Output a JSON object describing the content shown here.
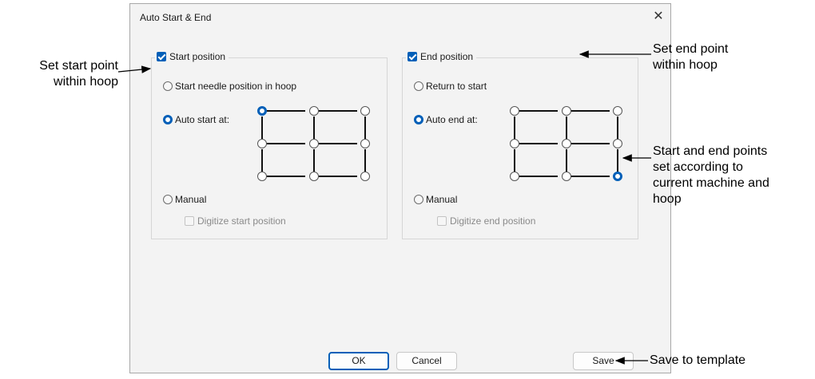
{
  "dialog": {
    "title": "Auto Start & End",
    "close_glyph": "✕"
  },
  "start_group": {
    "label": "Start position",
    "checked": true,
    "options": {
      "needle": "Start needle position in hoop",
      "auto": "Auto start at:",
      "manual": "Manual"
    },
    "selected": "auto",
    "digitize_label": "Digitize start position",
    "grid_selected": "top-left"
  },
  "end_group": {
    "label": "End position",
    "checked": true,
    "options": {
      "return": "Return to start",
      "auto": "Auto end at:",
      "manual": "Manual"
    },
    "selected": "auto",
    "digitize_label": "Digitize end position",
    "grid_selected": "bottom-right"
  },
  "buttons": {
    "ok": "OK",
    "cancel": "Cancel",
    "save": "Save"
  },
  "annotations": {
    "start_1": "Set start point",
    "start_2": "within hoop",
    "end_1": "Set end point",
    "end_2": "within hoop",
    "points_1": "Start and end points",
    "points_2": "set according to",
    "points_3": "current machine and",
    "points_4": "hoop",
    "save": "Save to template"
  },
  "colors": {
    "accent": "#005fb8",
    "dialog_bg": "#f3f3f3",
    "disabled_text": "#8a8a8a"
  },
  "icons": {
    "close": "close-icon",
    "checkbox": "checkbox-icon",
    "radio": "radio-icon"
  }
}
